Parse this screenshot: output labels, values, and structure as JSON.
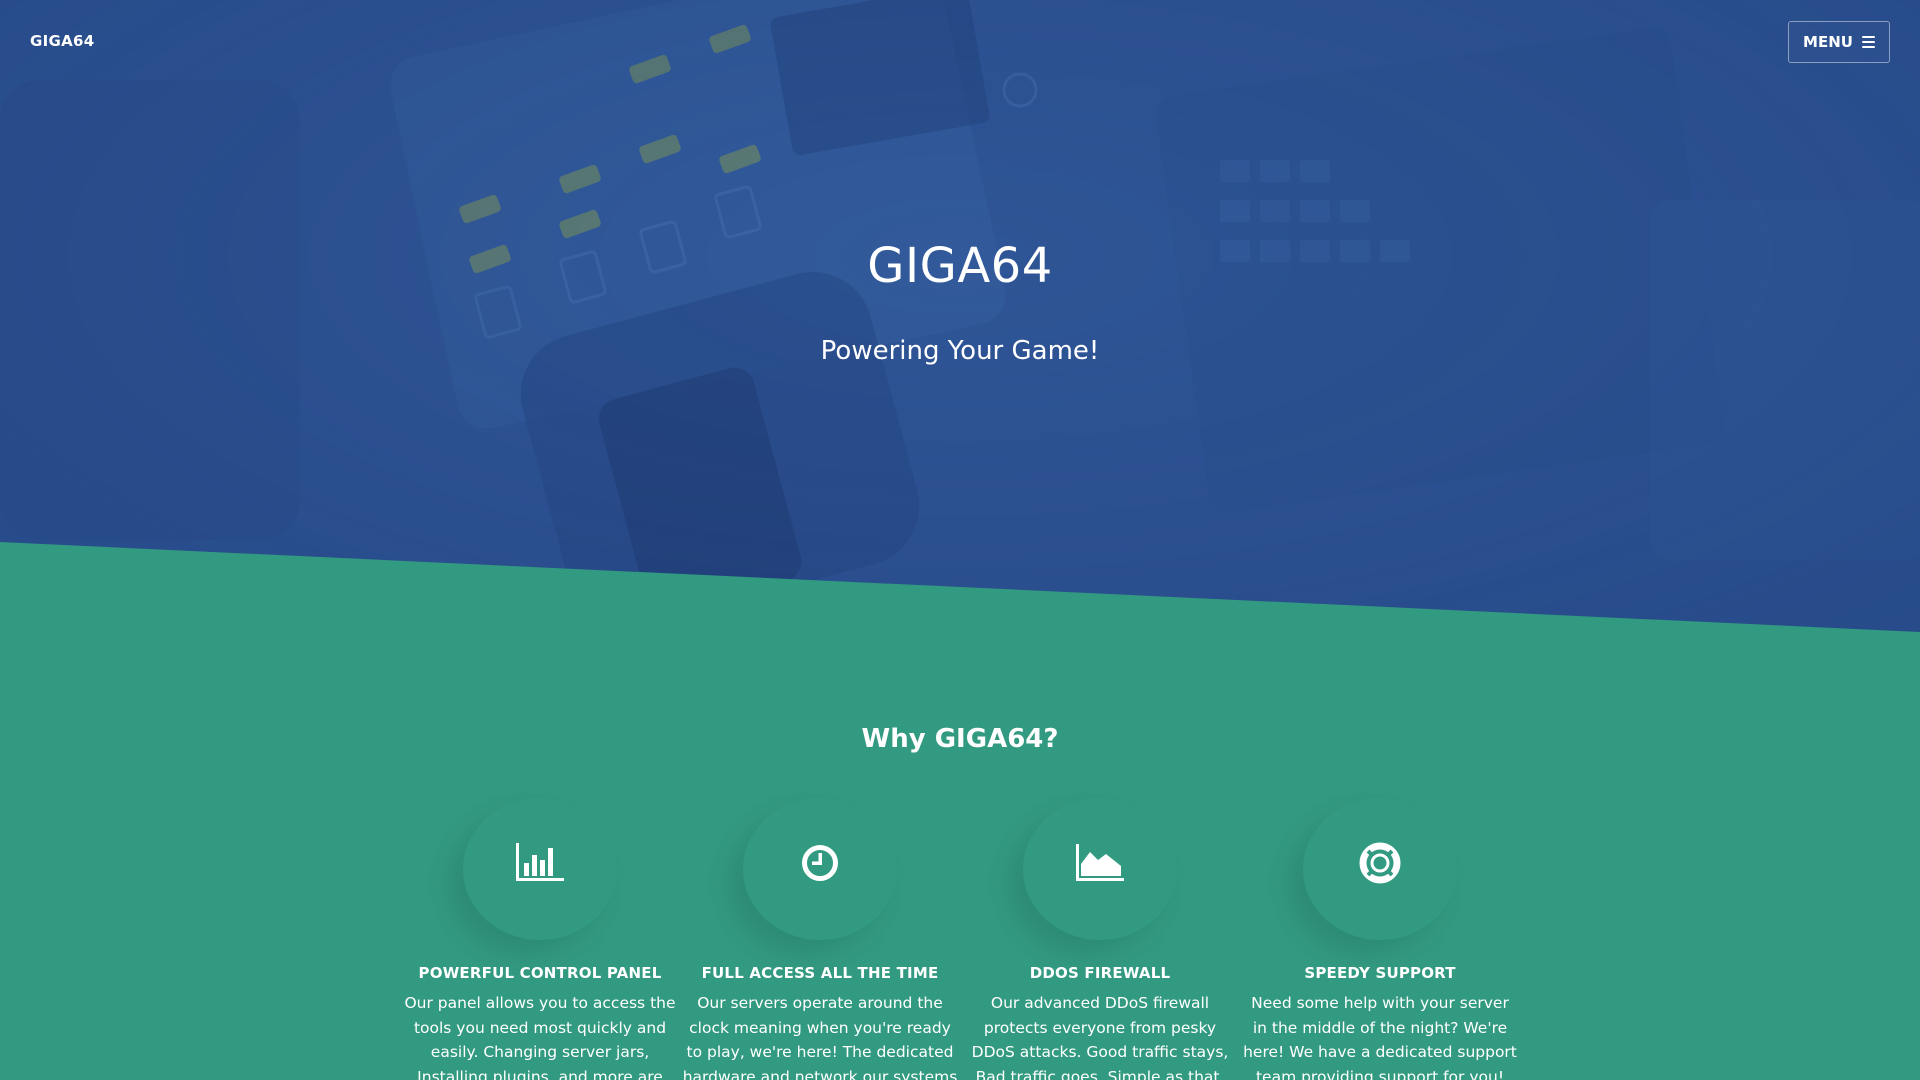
{
  "nav": {
    "brand": "GIGA64",
    "menu_label": "MENU"
  },
  "hero": {
    "title": "GIGA64",
    "subtitle": "Powering Your Game!"
  },
  "features_section": {
    "title": "Why GIGA64?",
    "items": [
      {
        "icon": "bar-chart-icon",
        "title": "POWERFUL CONTROL PANEL",
        "text": "Our panel allows you to access the tools you need most quickly and easily. Changing server jars, Installing plugins, and more are just"
      },
      {
        "icon": "clock-icon",
        "title": "FULL ACCESS ALL THE TIME",
        "text": "Our servers operate around the clock meaning when you're ready to play, we're here! The dedicated hardware and network our systems"
      },
      {
        "icon": "area-chart-icon",
        "title": "DDOS FIREWALL",
        "text": "Our advanced DDoS firewall protects everyone from pesky DDoS attacks. Good traffic stays, Bad traffic goes. Simple as that."
      },
      {
        "icon": "life-ring-icon",
        "title": "SPEEDY SUPPORT",
        "text": "Need some help with your server in the middle of the night? We're here! We have a dedicated support team providing support for you!"
      }
    ]
  },
  "colors": {
    "hero_blue": "#2d5393",
    "section_green": "#329a80",
    "text": "#ffffff"
  }
}
